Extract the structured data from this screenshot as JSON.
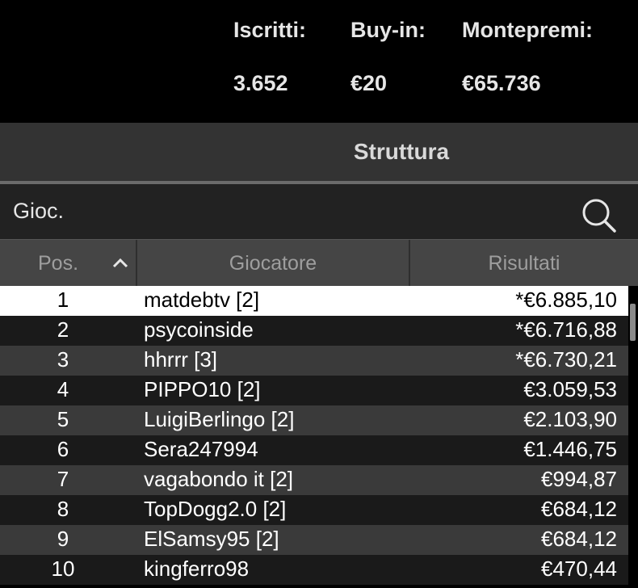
{
  "stats": {
    "entrants_label": "Iscritti:",
    "entrants_value": "3.652",
    "buyin_label": "Buy-in:",
    "buyin_value": "€20",
    "prizepool_label": "Montepremi:",
    "prizepool_value": "€65.736"
  },
  "structure": {
    "label": "Struttura"
  },
  "search": {
    "text": "Gioc.",
    "icon": "search-icon"
  },
  "table": {
    "columns": [
      "Pos.",
      "Giocatore",
      "Risultati"
    ],
    "sort_icon": "chevron-up-icon",
    "rows": [
      {
        "pos": "1",
        "name": "matdebtv [2]",
        "result": "*€6.885,10",
        "selected": true
      },
      {
        "pos": "2",
        "name": "psycoinside",
        "result": "*€6.716,88"
      },
      {
        "pos": "3",
        "name": "hhrrr [3]",
        "result": "*€6.730,21"
      },
      {
        "pos": "4",
        "name": "PIPPO10 [2]",
        "result": "€3.059,53"
      },
      {
        "pos": "5",
        "name": "LuigiBerlingo [2]",
        "result": "€2.103,90"
      },
      {
        "pos": "6",
        "name": "Sera247994",
        "result": "€1.446,75"
      },
      {
        "pos": "7",
        "name": "vagabondo it [2]",
        "result": "€994,87"
      },
      {
        "pos": "8",
        "name": "TopDogg2.0 [2]",
        "result": "€684,12"
      },
      {
        "pos": "9",
        "name": "ElSamsy95 [2]",
        "result": "€684,12"
      },
      {
        "pos": "10",
        "name": "kingferro98",
        "result": "€470,44"
      }
    ]
  },
  "colors": {
    "background": "#000000",
    "panel": "#333333",
    "header": "#454545",
    "row_dark": "#1a1a1a",
    "row_light": "#3a3a3a",
    "selected_row": "#ffffff"
  }
}
